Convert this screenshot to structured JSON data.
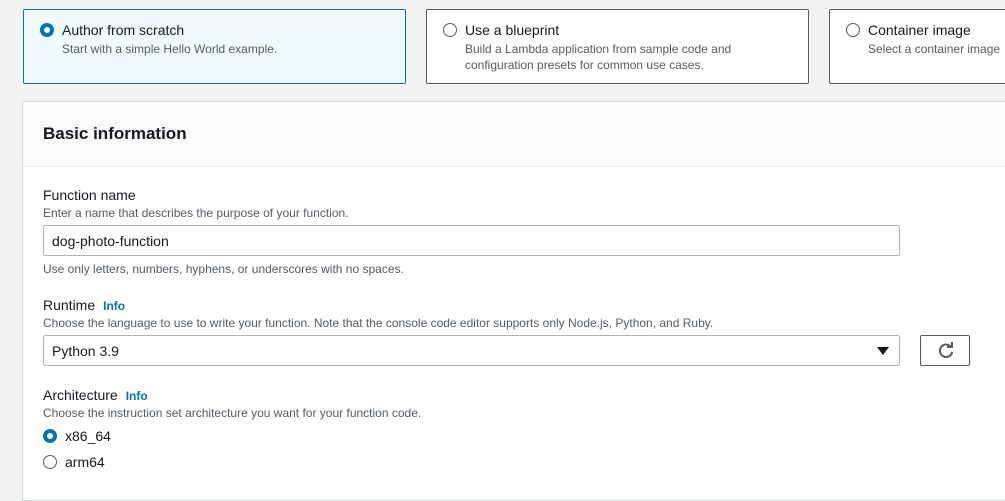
{
  "creation_options": [
    {
      "title": "Author from scratch",
      "description": [
        "Start with a simple Hello World example."
      ],
      "selected": true
    },
    {
      "title": "Use a blueprint",
      "description": [
        "Build a Lambda application from sample code and",
        "configuration presets for common use cases."
      ],
      "selected": false
    },
    {
      "title": "Container image",
      "description": [
        "Select a container image"
      ],
      "selected": false
    }
  ],
  "basic_info": {
    "title": "Basic information",
    "function_name": {
      "label": "Function name",
      "description": "Enter a name that describes the purpose of your function.",
      "value": "dog-photo-function",
      "constraint": "Use only letters, numbers, hyphens, or underscores with no spaces."
    },
    "runtime": {
      "label": "Runtime",
      "info": "Info",
      "description": "Choose the language to use to write your function. Note that the console code editor supports only Node.js, Python, and Ruby.",
      "selected": "Python 3.9",
      "refresh_icon": "refresh-icon"
    },
    "architecture": {
      "label": "Architecture",
      "info": "Info",
      "description": "Choose the instruction set architecture you want for your function code.",
      "options": [
        {
          "label": "x86_64",
          "checked": true
        },
        {
          "label": "arm64",
          "checked": false
        }
      ]
    }
  },
  "colors": {
    "accent": "#0073bb",
    "text": "#16191f",
    "muted": "#545b64",
    "background": "#f2f3f3"
  }
}
